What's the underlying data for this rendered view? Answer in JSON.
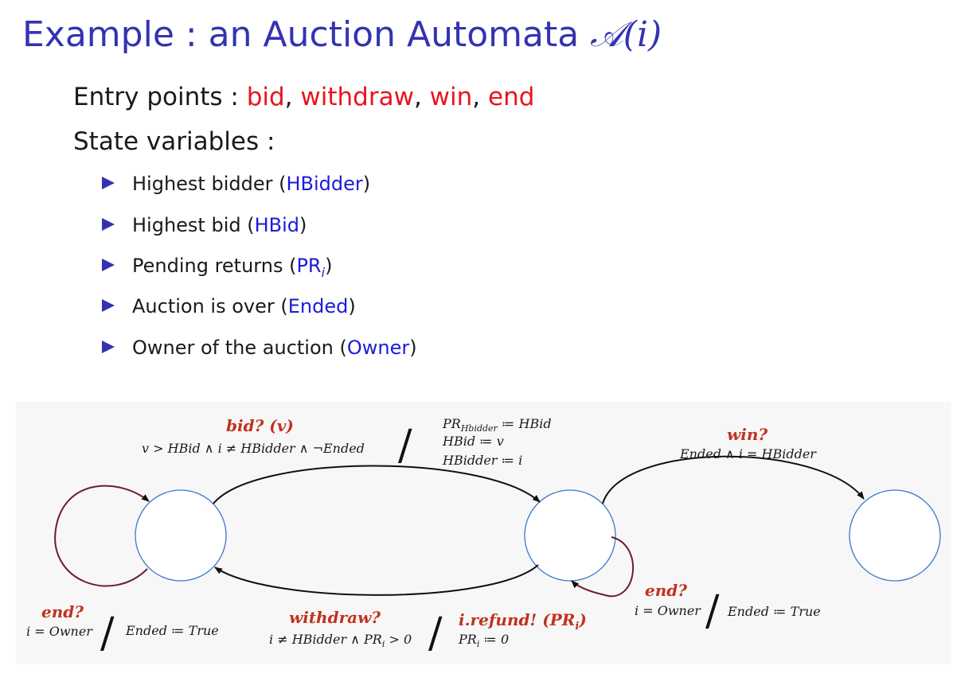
{
  "title": {
    "prefix": "Example : an Auction Automata ",
    "math": "𝒜(i)"
  },
  "entry_points": {
    "label": "Entry points : ",
    "items": [
      "bid",
      "withdraw",
      "win",
      "end"
    ],
    "separator": ", "
  },
  "state_variables": {
    "label": "State variables :",
    "items": [
      {
        "text": "Highest bidder (",
        "code": "HBidder",
        "close": ")"
      },
      {
        "text": "Highest bid (",
        "code": "HBid",
        "close": ")"
      },
      {
        "text": "Pending returns (",
        "code": "PR",
        "sub": "i",
        "close": ")"
      },
      {
        "text": "Auction is over (",
        "code": "Ended",
        "close": ")"
      },
      {
        "text": "Owner of the auction (",
        "code": "Owner",
        "close": ")"
      }
    ]
  },
  "diagram": {
    "bid": {
      "event": "bid? (v)",
      "guard": "v > HBid ∧ i ≠ HBidder ∧ ¬Ended",
      "actions": [
        "PR",
        "Hbidder",
        " ≔ HBid",
        "HBid  ≔ v",
        "HBidder  ≔ i"
      ]
    },
    "win": {
      "event": "win?",
      "guard": "Ended ∧ i = HBidder"
    },
    "end_left": {
      "event": "end?",
      "guard": "i = Owner",
      "action": "Ended ≔ True"
    },
    "withdraw": {
      "event": "withdraw?",
      "guard_a": "i ≠ HBidder ∧ PR",
      "guard_sub": "i",
      "guard_b": " > 0",
      "output": "i.refund! (PR",
      "output_sub": "i",
      "output_close": ")",
      "action_a": "PR",
      "action_sub": "i",
      "action_b": " ≔ 0"
    },
    "end_right": {
      "event": "end?",
      "guard": "i = Owner",
      "action": "Ended ≔ True"
    },
    "slash": "/"
  },
  "colors": {
    "title": "#3333b2",
    "entry": "#e8141e",
    "var": "#1b1bd8",
    "label": "#c1321f",
    "state_stroke": "#3a78c7",
    "loop": "#6b1d2e"
  }
}
